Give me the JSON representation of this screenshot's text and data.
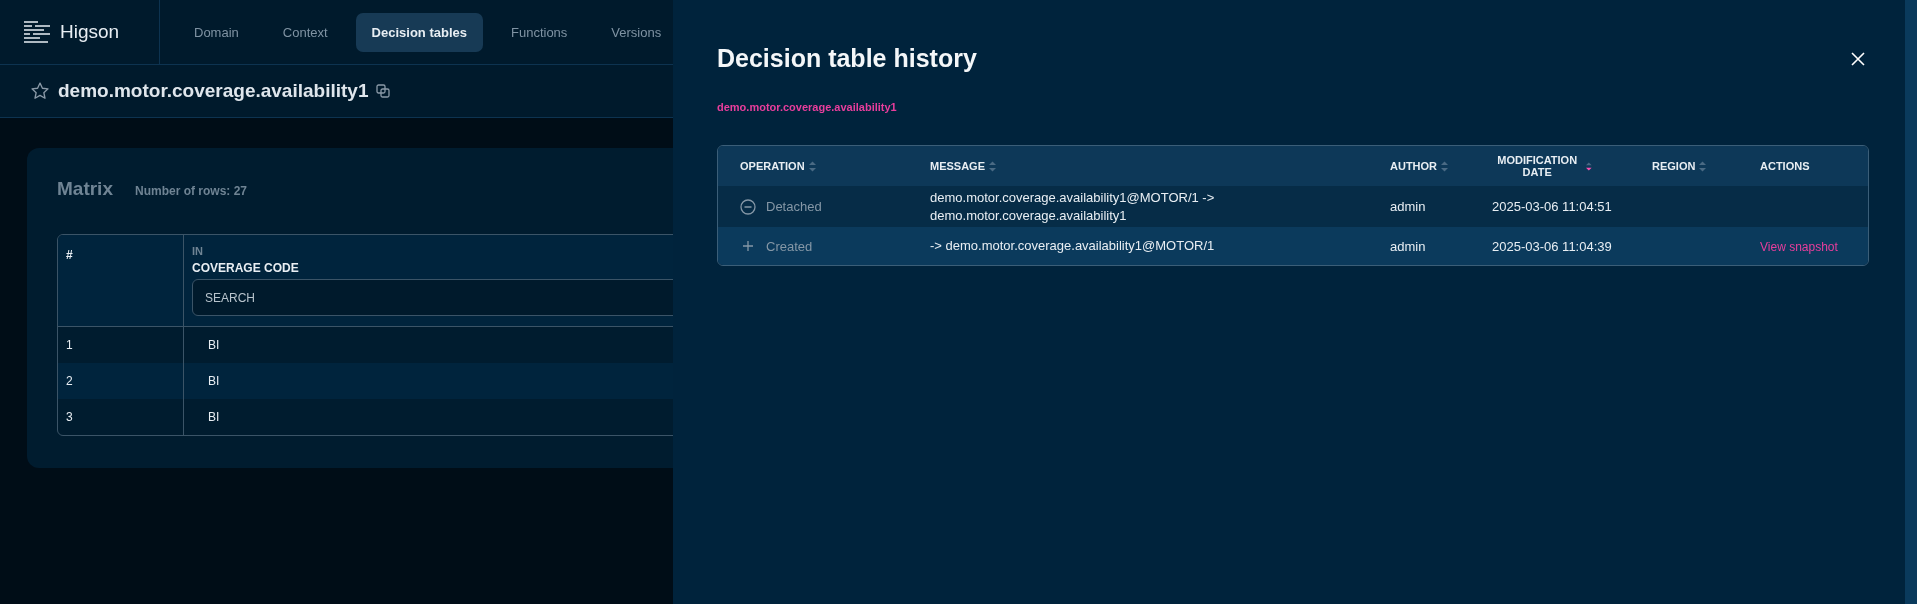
{
  "app": {
    "logo": "Higson",
    "tabs": [
      {
        "label": "Domain",
        "selected": false
      },
      {
        "label": "Context",
        "selected": false
      },
      {
        "label": "Decision tables",
        "selected": true
      },
      {
        "label": "Functions",
        "selected": false
      },
      {
        "label": "Versions",
        "selected": false
      }
    ]
  },
  "page": {
    "title": "demo.motor.coverage.availability1",
    "starred": false
  },
  "matrix": {
    "title": "Matrix",
    "row_count": "Number of rows: 27",
    "index_header": "#",
    "column": {
      "group": "IN",
      "label": "COVERAGE CODE",
      "placeholder": "SEARCH"
    },
    "rows": [
      {
        "index": "1",
        "value": "BI"
      },
      {
        "index": "2",
        "value": "BI"
      },
      {
        "index": "3",
        "value": "BI"
      }
    ]
  },
  "drawer": {
    "title": "Decision table history",
    "subtitle": "demo.motor.coverage.availability1",
    "columns": [
      {
        "label": "OPERATION",
        "sorted": false
      },
      {
        "label": "MESSAGE",
        "sorted": false
      },
      {
        "label": "AUTHOR",
        "sorted": false
      },
      {
        "label": "MODIFICATION DATE",
        "sorted": true
      },
      {
        "label": "REGION",
        "sorted": false
      },
      {
        "label": "ACTIONS"
      }
    ],
    "rows": [
      {
        "kind": "detached",
        "operation": "Detached",
        "message": "demo.motor.coverage.availability1@MOTOR/1 -> demo.motor.coverage.availability1",
        "author": "admin",
        "date": "2025-03-06 11:04:51"
      },
      {
        "kind": "created",
        "operation": "Created",
        "message": "-> demo.motor.coverage.availability1@MOTOR/1",
        "author": "admin",
        "date": "2025-03-06 11:04:39",
        "action": "View snapshot"
      }
    ]
  }
}
